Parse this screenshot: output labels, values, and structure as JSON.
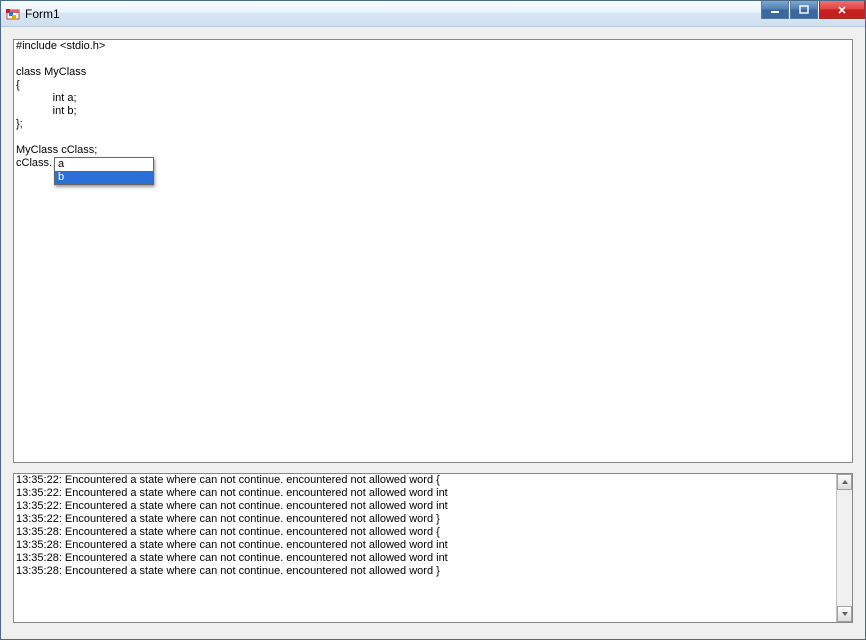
{
  "window": {
    "title": "Form1"
  },
  "editor": {
    "lines": [
      "#include <stdio.h>",
      "",
      "class MyClass",
      "{",
      "            int a;",
      "            int b;",
      "};",
      "",
      "MyClass cClass;",
      "cClass."
    ]
  },
  "intellisense": {
    "items": [
      {
        "label": "a",
        "selected": false
      },
      {
        "label": "b",
        "selected": true
      }
    ]
  },
  "log": {
    "lines": [
      "13:35:22: Encountered a state where can not continue. encountered not allowed word {",
      "13:35:22: Encountered a state where can not continue. encountered not allowed word int",
      "13:35:22: Encountered a state where can not continue. encountered not allowed word int",
      "13:35:22: Encountered a state where can not continue. encountered not allowed word }",
      "13:35:28: Encountered a state where can not continue. encountered not allowed word {",
      "13:35:28: Encountered a state where can not continue. encountered not allowed word int",
      "13:35:28: Encountered a state where can not continue. encountered not allowed word int",
      "13:35:28: Encountered a state where can not continue. encountered not allowed word }"
    ]
  }
}
